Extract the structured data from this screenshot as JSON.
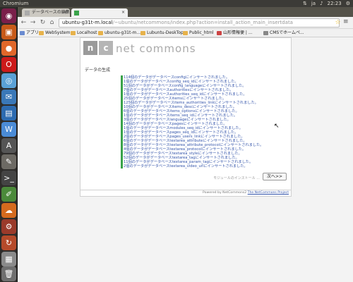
{
  "os": {
    "app_title": "Chromium",
    "tray": {
      "keyboard": "ja",
      "time": "22:23"
    }
  },
  "browser": {
    "tabs": [
      {
        "label": "データベースの編集"
      },
      {
        "label": ""
      }
    ],
    "url_host": "ubuntu-g31t-m.local",
    "url_path": "/~ubuntu/netcommons/index.php?action=install_action_main_insertdata",
    "bookmarks": [
      {
        "label": "アプリ"
      },
      {
        "label": "WebSystem"
      },
      {
        "label": "Localhost"
      },
      {
        "label": "ubuntu-g31t-m..."
      },
      {
        "label": "Lubuntu-DeskTop"
      },
      {
        "label": "Public_html"
      },
      {
        "label": "山形情報便 | ..."
      },
      {
        "label": "CMSでホームペ..."
      }
    ]
  },
  "page": {
    "logo_text": "net commons",
    "section_title": "データの生成",
    "log_lines": [
      "114個のデータがデータベースconfigにインサートされました。",
      "1個のデータがデータベースconfig_seq_idにインサートされました。",
      "51個のデータがデータベースconfig_languageにインサートされました。",
      "7個のデータがデータベースauthoritiesにインサートされました。",
      "1個のデータがデータベースauthorities_seq_idにインサートされました。",
      "25個のデータがデータベースitemsにインサートされました。",
      "125個のデータがデータベースitems_authorities_linkにインサートされました。",
      "10個のデータがデータベースitems_descにインサートされました。",
      "6個のデータがデータベースitems_optionsにインサートされました。",
      "1個のデータがデータベースitems_seq_idにインサートされました。",
      "3個のデータがデータベースlanguageにインサートされました。",
      "14個のデータがデータベースpagesにインサートされました。",
      "1個のデータがデータベースmodules_seq_idにインサートされました。",
      "1個のデータがデータベースpages_seq_idにインサートされました。",
      "2個のデータがデータベースpages_users_linkにインサートされました。",
      "6個のデータがデータベースtextarea_attributeにインサートされました。",
      "8個のデータがデータベースtextarea_attribute_protocolにインサートされました。",
      "4個のデータがデータベースtextarea_protocolにインサートされました。",
      "79個のデータがデータベースtextarea_styleにインサートされました。",
      "52個のデータがデータベースtextarea_tagにインサートされました。",
      "11個のデータがデータベースtextarea_param_tagにインサートされました。",
      "2個のデータがデータベースtextarea_video_urlにインサートされました。"
    ],
    "footer_hint": "モジュールのインストール ...",
    "next_button": "次へ>>",
    "powered_by": "Powered by NetCommons2",
    "project_link": "The NetCommons Project"
  }
}
